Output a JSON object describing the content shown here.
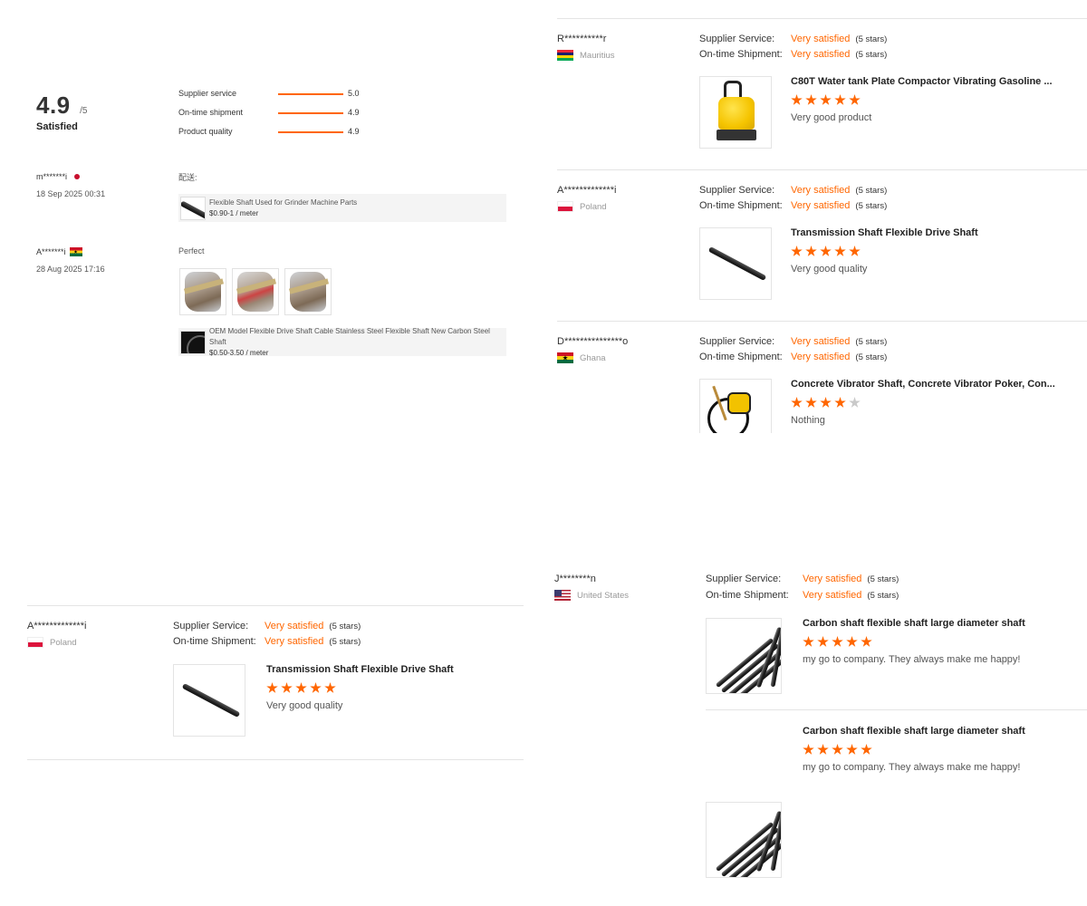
{
  "summary": {
    "score": "4.9",
    "score_max": "/5",
    "score_word": "Satisfied",
    "metrics": [
      {
        "label": "Supplier service",
        "value": "5.0"
      },
      {
        "label": "On-time shipment",
        "value": "4.9"
      },
      {
        "label": "Product quality",
        "value": "4.9"
      }
    ]
  },
  "compact_reviews": [
    {
      "name": "m*******i",
      "flag": "japan",
      "date": "18 Sep 2025 00:31",
      "text": "配送:",
      "product": {
        "title": "Flexible Shaft Used for Grinder Machine Parts",
        "price": "$0.90-1 / meter"
      }
    },
    {
      "name": "A*******i",
      "flag": "ghana",
      "date": "28 Aug 2025 17:16",
      "text": "Perfect",
      "photos": [
        "photo-1",
        "photo-2",
        "photo-3"
      ],
      "product": {
        "title": "OEM Model Flexible Drive Shaft Cable Stainless Steel Flexible Shaft New Carbon Steel Shaft",
        "price": "$0.50-3.50 / meter"
      }
    }
  ],
  "labels": {
    "supplier_service": "Supplier Service:",
    "ontime_shipment": "On-time Shipment:",
    "very_satisfied": "Very satisfied",
    "five_stars": "(5 stars)"
  },
  "reviews_right": [
    {
      "name": "R**********r",
      "country": "Mauritius",
      "flag": "mauritius",
      "product_title": "C80T Water tank Plate Compactor Vibrating Gasoline ...",
      "rating": 5,
      "comment": "Very good product"
    },
    {
      "name": "A*************i",
      "country": "Poland",
      "flag": "poland",
      "product_title": "Transmission Shaft Flexible Drive Shaft",
      "rating": 5,
      "comment": "Very good quality"
    },
    {
      "name": "D***************o",
      "country": "Ghana",
      "flag": "ghana",
      "product_title": "Concrete Vibrator Shaft, Concrete Vibrator Poker, Con...",
      "rating": 4,
      "comment": "Nothing"
    }
  ],
  "review_poland_bottom": {
    "name": "A*************i",
    "country": "Poland",
    "product_title": "Transmission Shaft Flexible Drive Shaft",
    "rating": 5,
    "comment": "Very good quality"
  },
  "review_us": {
    "name": "J********n",
    "country": "United States",
    "items": [
      {
        "product_title": "Carbon shaft flexible shaft large diameter shaft",
        "rating": 5,
        "comment": "my go to company. They always make me happy!"
      },
      {
        "product_title": "Carbon shaft flexible shaft large diameter shaft",
        "rating": 5,
        "comment": "my go to company. They always make me happy!"
      }
    ]
  },
  "colors": {
    "accent": "#ff6600",
    "divider": "#e4e4e4",
    "star_off": "#c9c9c9"
  }
}
